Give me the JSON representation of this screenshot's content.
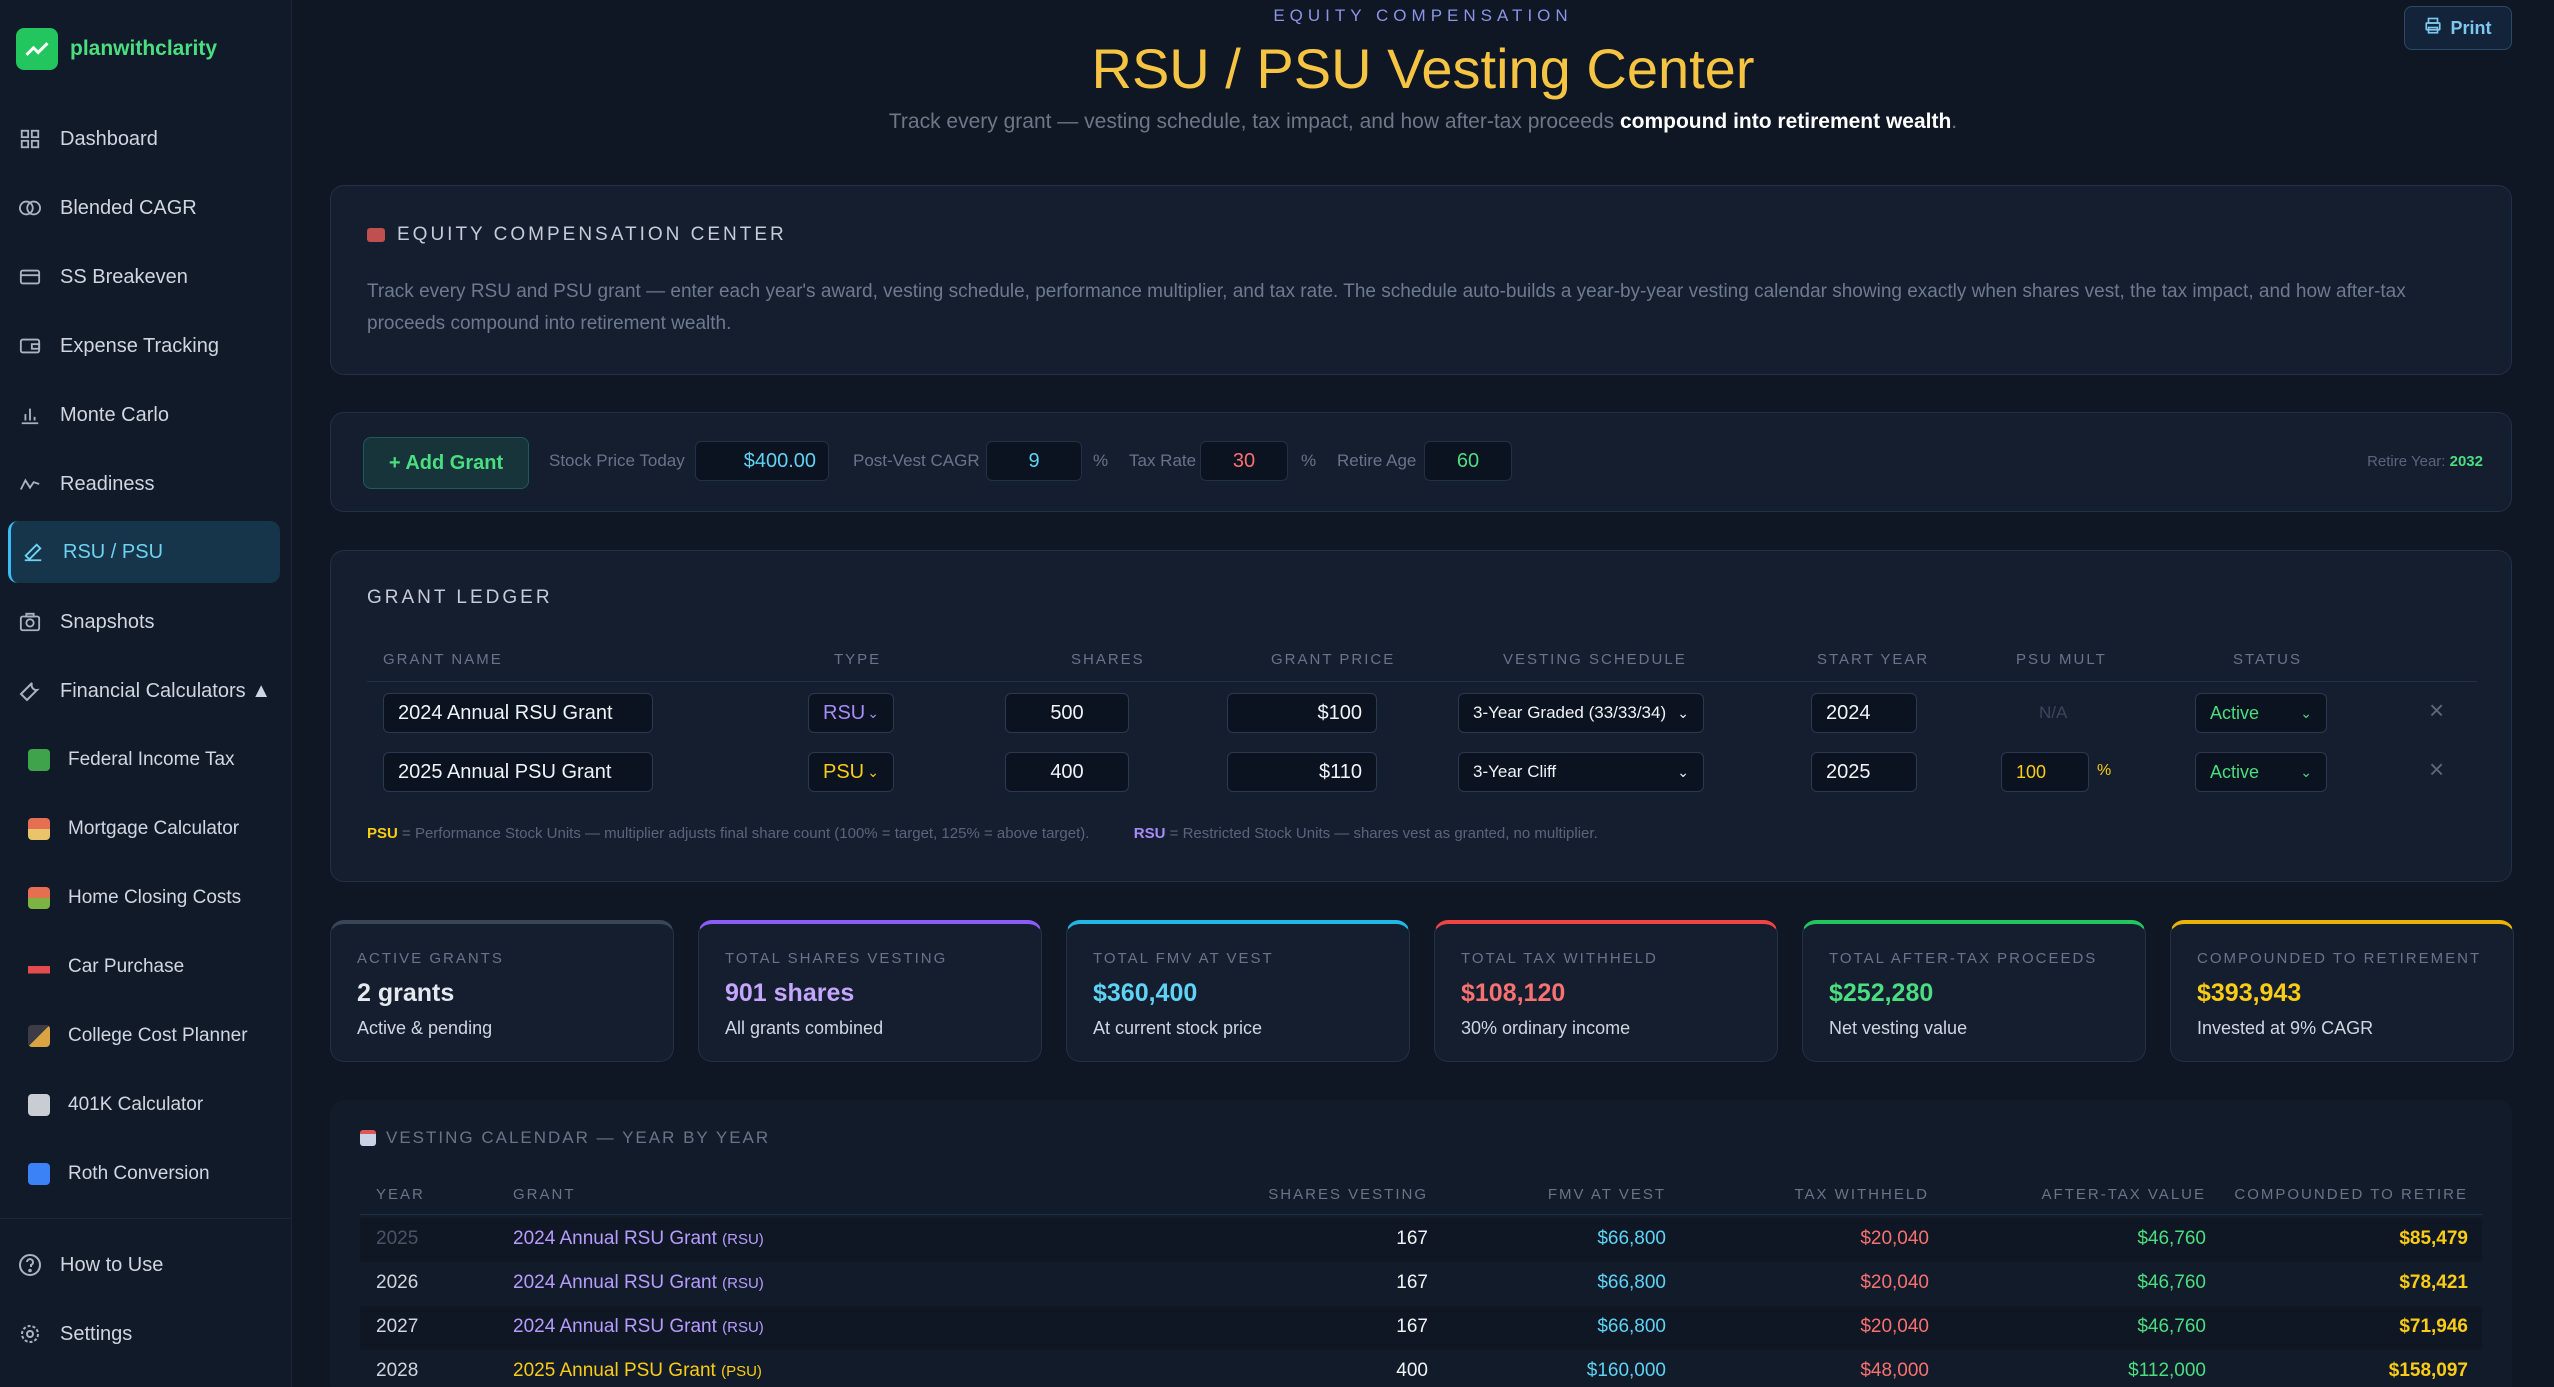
{
  "brand": {
    "name": "planwithclarity"
  },
  "nav": {
    "items": [
      {
        "label": "Dashboard",
        "icon": "grid-icon"
      },
      {
        "label": "Blended CAGR",
        "icon": "rings-icon"
      },
      {
        "label": "SS Breakeven",
        "icon": "card-icon"
      },
      {
        "label": "Expense Tracking",
        "icon": "wallet-icon"
      },
      {
        "label": "Monte Carlo",
        "icon": "bar-chart-icon"
      },
      {
        "label": "Readiness",
        "icon": "pulse-icon"
      },
      {
        "label": "RSU / PSU",
        "icon": "pen-chart-icon"
      },
      {
        "label": "Snapshots",
        "icon": "camera-icon"
      },
      {
        "label": "Financial Calculators ▲",
        "icon": "wrench-icon"
      }
    ],
    "calculators": [
      {
        "label": "Federal Income Tax",
        "icon": "money-icon"
      },
      {
        "label": "Mortgage Calculator",
        "icon": "house-icon"
      },
      {
        "label": "Home Closing Costs",
        "icon": "house-key-icon"
      },
      {
        "label": "Car Purchase",
        "icon": "car-icon"
      },
      {
        "label": "College Cost Planner",
        "icon": "cap-icon"
      },
      {
        "label": "401K Calculator",
        "icon": "bank-icon"
      },
      {
        "label": "Roth Conversion",
        "icon": "convert-icon"
      }
    ],
    "footer": [
      {
        "label": "How to Use",
        "icon": "help-icon"
      },
      {
        "label": "Settings",
        "icon": "gear-icon"
      }
    ]
  },
  "header": {
    "eyebrow": "EQUITY COMPENSATION",
    "title": "RSU / PSU Vesting Center",
    "subtitle_plain": "Track every grant — vesting schedule, tax impact, and how after-tax proceeds",
    "subtitle_bold": "compound into retirement wealth",
    "subtitle_end": ".",
    "print_label": "Print"
  },
  "intro": {
    "heading": "EQUITY COMPENSATION CENTER",
    "text": "Track every RSU and PSU grant — enter each year's award, vesting schedule, performance multiplier, and tax rate. The schedule auto-builds a year-by-year vesting calendar showing exactly when shares vest, the tax impact, and how after-tax proceeds compound into retirement wealth."
  },
  "controls": {
    "add_grant": "+ Add Grant",
    "stock_price_label": "Stock Price Today",
    "stock_price": "$400.00",
    "cagr_label": "Post-Vest CAGR",
    "cagr": "9",
    "tax_label": "Tax Rate",
    "tax": "30",
    "retire_age_label": "Retire Age",
    "retire_age": "60",
    "pct": "%",
    "retire_year_label": "Retire Year:",
    "retire_year": "2032"
  },
  "ledger": {
    "heading": "GRANT LEDGER",
    "columns": [
      "GRANT NAME",
      "TYPE",
      "SHARES",
      "GRANT PRICE",
      "VESTING SCHEDULE",
      "START YEAR",
      "PSU MULT",
      "STATUS"
    ],
    "rows": [
      {
        "name": "2024 Annual RSU Grant",
        "type": "RSU",
        "shares": "500",
        "price": "$100",
        "schedule": "3-Year Graded (33/33/34)",
        "start": "2024",
        "mult": "N/A",
        "status": "Active"
      },
      {
        "name": "2025 Annual PSU Grant",
        "type": "PSU",
        "shares": "400",
        "price": "$110",
        "schedule": "3-Year Cliff",
        "start": "2025",
        "mult": "100",
        "status": "Active"
      }
    ],
    "legend_psu_tag": "PSU",
    "legend_psu": " = Performance Stock Units — multiplier adjusts final share count (100% = target, 125% = above target).",
    "legend_rsu_tag": "RSU",
    "legend_rsu": " = Restricted Stock Units — shares vest as granted, no multiplier."
  },
  "stats": [
    {
      "label": "ACTIVE GRANTS",
      "value": "2 grants",
      "sub": "Active & pending",
      "color": "#e6e9ef",
      "accent": "#3a4658"
    },
    {
      "label": "TOTAL SHARES VESTING",
      "value": "901 shares",
      "sub": "All grants combined",
      "color": "#c4a6ff",
      "accent": "#8b5cf6"
    },
    {
      "label": "TOTAL FMV AT VEST",
      "value": "$360,400",
      "sub": "At current stock price",
      "color": "#5ed3f5",
      "accent": "#22b8e6"
    },
    {
      "label": "TOTAL TAX WITHHELD",
      "value": "$108,120",
      "sub": "30% ordinary income",
      "color": "#f87171",
      "accent": "#ef4444"
    },
    {
      "label": "TOTAL AFTER-TAX PROCEEDS",
      "value": "$252,280",
      "sub": "Net vesting value",
      "color": "#4ade80",
      "accent": "#22c55e"
    },
    {
      "label": "COMPOUNDED TO RETIREMENT",
      "value": "$393,943",
      "sub": "Invested at 9% CAGR",
      "color": "#facc15",
      "accent": "#eab308"
    }
  ],
  "calendar": {
    "heading": "VESTING CALENDAR — YEAR BY YEAR",
    "columns": [
      "YEAR",
      "GRANT",
      "SHARES VESTING",
      "FMV AT VEST",
      "TAX WITHHELD",
      "AFTER-TAX VALUE",
      "COMPOUNDED TO RETIRE"
    ],
    "rows": [
      {
        "year": "2025",
        "grant": "2024 Annual RSU Grant",
        "tag": "(RSU)",
        "shares": "167",
        "fmv": "$66,800",
        "tax": "$20,040",
        "after": "$46,760",
        "comp": "$85,479"
      },
      {
        "year": "2026",
        "grant": "2024 Annual RSU Grant",
        "tag": "(RSU)",
        "shares": "167",
        "fmv": "$66,800",
        "tax": "$20,040",
        "after": "$46,760",
        "comp": "$78,421"
      },
      {
        "year": "2027",
        "grant": "2024 Annual RSU Grant",
        "tag": "(RSU)",
        "shares": "167",
        "fmv": "$66,800",
        "tax": "$20,040",
        "after": "$46,760",
        "comp": "$71,946"
      },
      {
        "year": "2028",
        "grant": "2025 Annual PSU Grant",
        "tag": "(PSU)",
        "shares": "400",
        "fmv": "$160,000",
        "tax": "$48,000",
        "after": "$112,000",
        "comp": "$158,097"
      }
    ]
  }
}
